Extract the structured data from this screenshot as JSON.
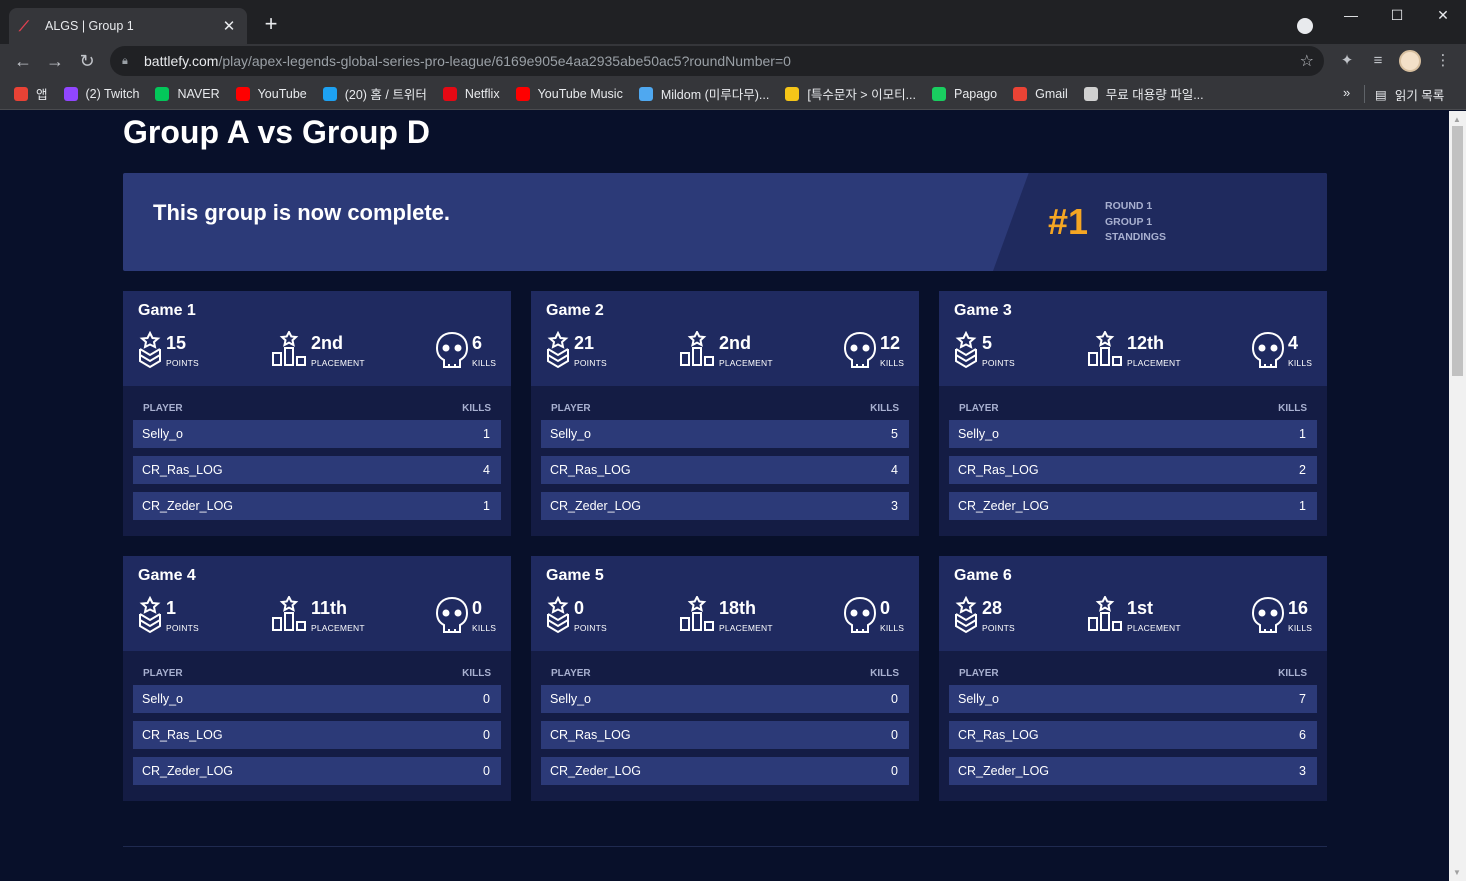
{
  "browser": {
    "tab_title": "ALGS | Group 1",
    "url_host": "battlefy.com",
    "url_path": "/play/apex-legends-global-series-pro-league/6169e905e4aa2935abe50ac5?roundNumber=0",
    "bookmarks": [
      {
        "label": "앱",
        "color": "#e94235"
      },
      {
        "label": "(2) Twitch",
        "color": "#9146ff"
      },
      {
        "label": "NAVER",
        "color": "#03c75a"
      },
      {
        "label": "YouTube",
        "color": "#ff0000"
      },
      {
        "label": "(20) 홈 / 트위터",
        "color": "#1da1f2"
      },
      {
        "label": "Netflix",
        "color": "#e50914"
      },
      {
        "label": "YouTube Music",
        "color": "#ff0000"
      },
      {
        "label": "Mildom (미루다무)...",
        "color": "#4fa8f0"
      },
      {
        "label": "[특수문자 > 이모티...",
        "color": "#f5c518"
      },
      {
        "label": "Papago",
        "color": "#19ce60"
      },
      {
        "label": "Gmail",
        "color": "#ea4335"
      },
      {
        "label": "무료 대용량 파일...",
        "color": "#d0d0d0"
      }
    ],
    "more_label": "»",
    "reading_list": "읽기 목록"
  },
  "page": {
    "heading": "Group A vs Group D",
    "banner": {
      "message": "This group is now complete.",
      "rank": "#1",
      "line1": "ROUND 1",
      "line2": "GROUP 1",
      "line3": "STANDINGS"
    },
    "labels": {
      "points": "POINTS",
      "placement": "PLACEMENT",
      "kills": "KILLS",
      "player_col": "PLAYER",
      "kills_col": "KILLS"
    },
    "games": [
      {
        "title": "Game 1",
        "points": "15",
        "placement": "2nd",
        "kills": "6",
        "players": [
          {
            "name": "Selly_o",
            "kills": "1"
          },
          {
            "name": "CR_Ras_LOG",
            "kills": "4"
          },
          {
            "name": "CR_Zeder_LOG",
            "kills": "1"
          }
        ]
      },
      {
        "title": "Game 2",
        "points": "21",
        "placement": "2nd",
        "kills": "12",
        "players": [
          {
            "name": "Selly_o",
            "kills": "5"
          },
          {
            "name": "CR_Ras_LOG",
            "kills": "4"
          },
          {
            "name": "CR_Zeder_LOG",
            "kills": "3"
          }
        ]
      },
      {
        "title": "Game 3",
        "points": "5",
        "placement": "12th",
        "kills": "4",
        "players": [
          {
            "name": "Selly_o",
            "kills": "1"
          },
          {
            "name": "CR_Ras_LOG",
            "kills": "2"
          },
          {
            "name": "CR_Zeder_LOG",
            "kills": "1"
          }
        ]
      },
      {
        "title": "Game 4",
        "points": "1",
        "placement": "11th",
        "kills": "0",
        "players": [
          {
            "name": "Selly_o",
            "kills": "0"
          },
          {
            "name": "CR_Ras_LOG",
            "kills": "0"
          },
          {
            "name": "CR_Zeder_LOG",
            "kills": "0"
          }
        ]
      },
      {
        "title": "Game 5",
        "points": "0",
        "placement": "18th",
        "kills": "0",
        "players": [
          {
            "name": "Selly_o",
            "kills": "0"
          },
          {
            "name": "CR_Ras_LOG",
            "kills": "0"
          },
          {
            "name": "CR_Zeder_LOG",
            "kills": "0"
          }
        ]
      },
      {
        "title": "Game 6",
        "points": "28",
        "placement": "1st",
        "kills": "16",
        "players": [
          {
            "name": "Selly_o",
            "kills": "7"
          },
          {
            "name": "CR_Ras_LOG",
            "kills": "6"
          },
          {
            "name": "CR_Zeder_LOG",
            "kills": "3"
          }
        ]
      }
    ]
  },
  "colors": {
    "page_bg": "#08102a",
    "card_head": "#1f2a60",
    "card_body": "#141c44",
    "row_bg": "#2c3a78",
    "rank_accent": "#f5a623"
  }
}
